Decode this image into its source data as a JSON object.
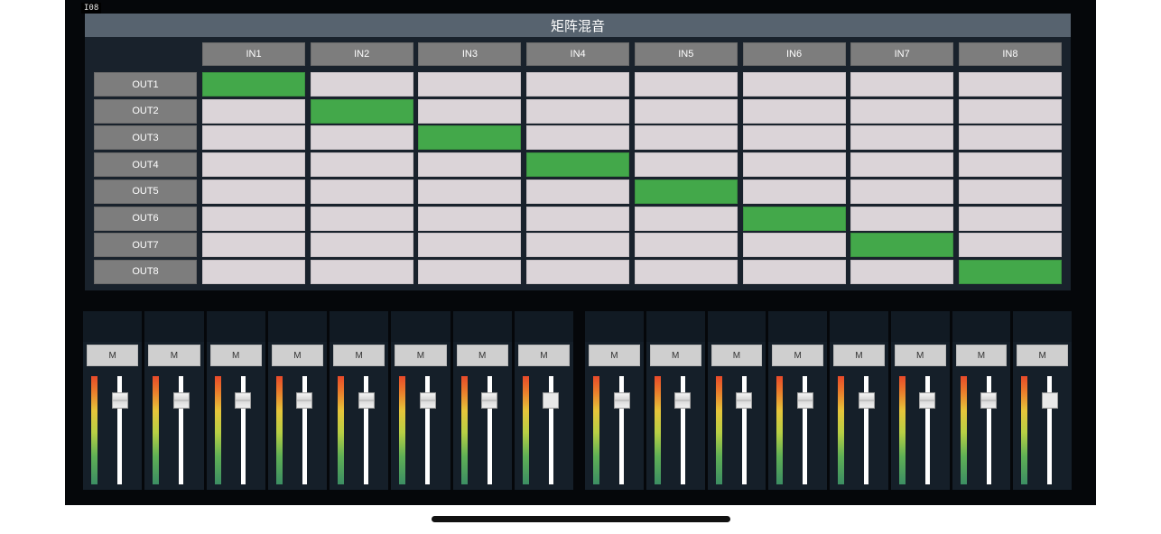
{
  "device": {
    "badge": "I08"
  },
  "title": "矩阵混音",
  "matrix": {
    "inputs": [
      "IN1",
      "IN2",
      "IN3",
      "IN4",
      "IN5",
      "IN6",
      "IN7",
      "IN8"
    ],
    "outputs": [
      "OUT1",
      "OUT2",
      "OUT3",
      "OUT4",
      "OUT5",
      "OUT6",
      "OUT7",
      "OUT8"
    ],
    "routing": [
      [
        1,
        0,
        0,
        0,
        0,
        0,
        0,
        0
      ],
      [
        0,
        1,
        0,
        0,
        0,
        0,
        0,
        0
      ],
      [
        0,
        0,
        1,
        0,
        0,
        0,
        0,
        0
      ],
      [
        0,
        0,
        0,
        1,
        0,
        0,
        0,
        0
      ],
      [
        0,
        0,
        0,
        0,
        1,
        0,
        0,
        0
      ],
      [
        0,
        0,
        0,
        0,
        0,
        1,
        0,
        0
      ],
      [
        0,
        0,
        0,
        0,
        0,
        0,
        1,
        0
      ],
      [
        0,
        0,
        0,
        0,
        0,
        0,
        0,
        1
      ]
    ],
    "colors": {
      "active": "#43a84a",
      "inactive": "#dbd4d8",
      "header": "#7d7d7d"
    }
  },
  "mixer": {
    "mute_label": "M",
    "input_strips": [
      {
        "fader": 0.82,
        "knob": "striped"
      },
      {
        "fader": 0.82,
        "knob": "striped"
      },
      {
        "fader": 0.82,
        "knob": "striped"
      },
      {
        "fader": 0.82,
        "knob": "striped"
      },
      {
        "fader": 0.82,
        "knob": "striped"
      },
      {
        "fader": 0.82,
        "knob": "striped"
      },
      {
        "fader": 0.82,
        "knob": "striped"
      },
      {
        "fader": 0.82,
        "knob": "plain"
      }
    ],
    "output_strips": [
      {
        "fader": 0.82,
        "knob": "striped"
      },
      {
        "fader": 0.82,
        "knob": "striped"
      },
      {
        "fader": 0.82,
        "knob": "striped"
      },
      {
        "fader": 0.82,
        "knob": "striped"
      },
      {
        "fader": 0.82,
        "knob": "striped"
      },
      {
        "fader": 0.82,
        "knob": "striped"
      },
      {
        "fader": 0.82,
        "knob": "striped"
      },
      {
        "fader": 0.82,
        "knob": "plain"
      }
    ]
  }
}
